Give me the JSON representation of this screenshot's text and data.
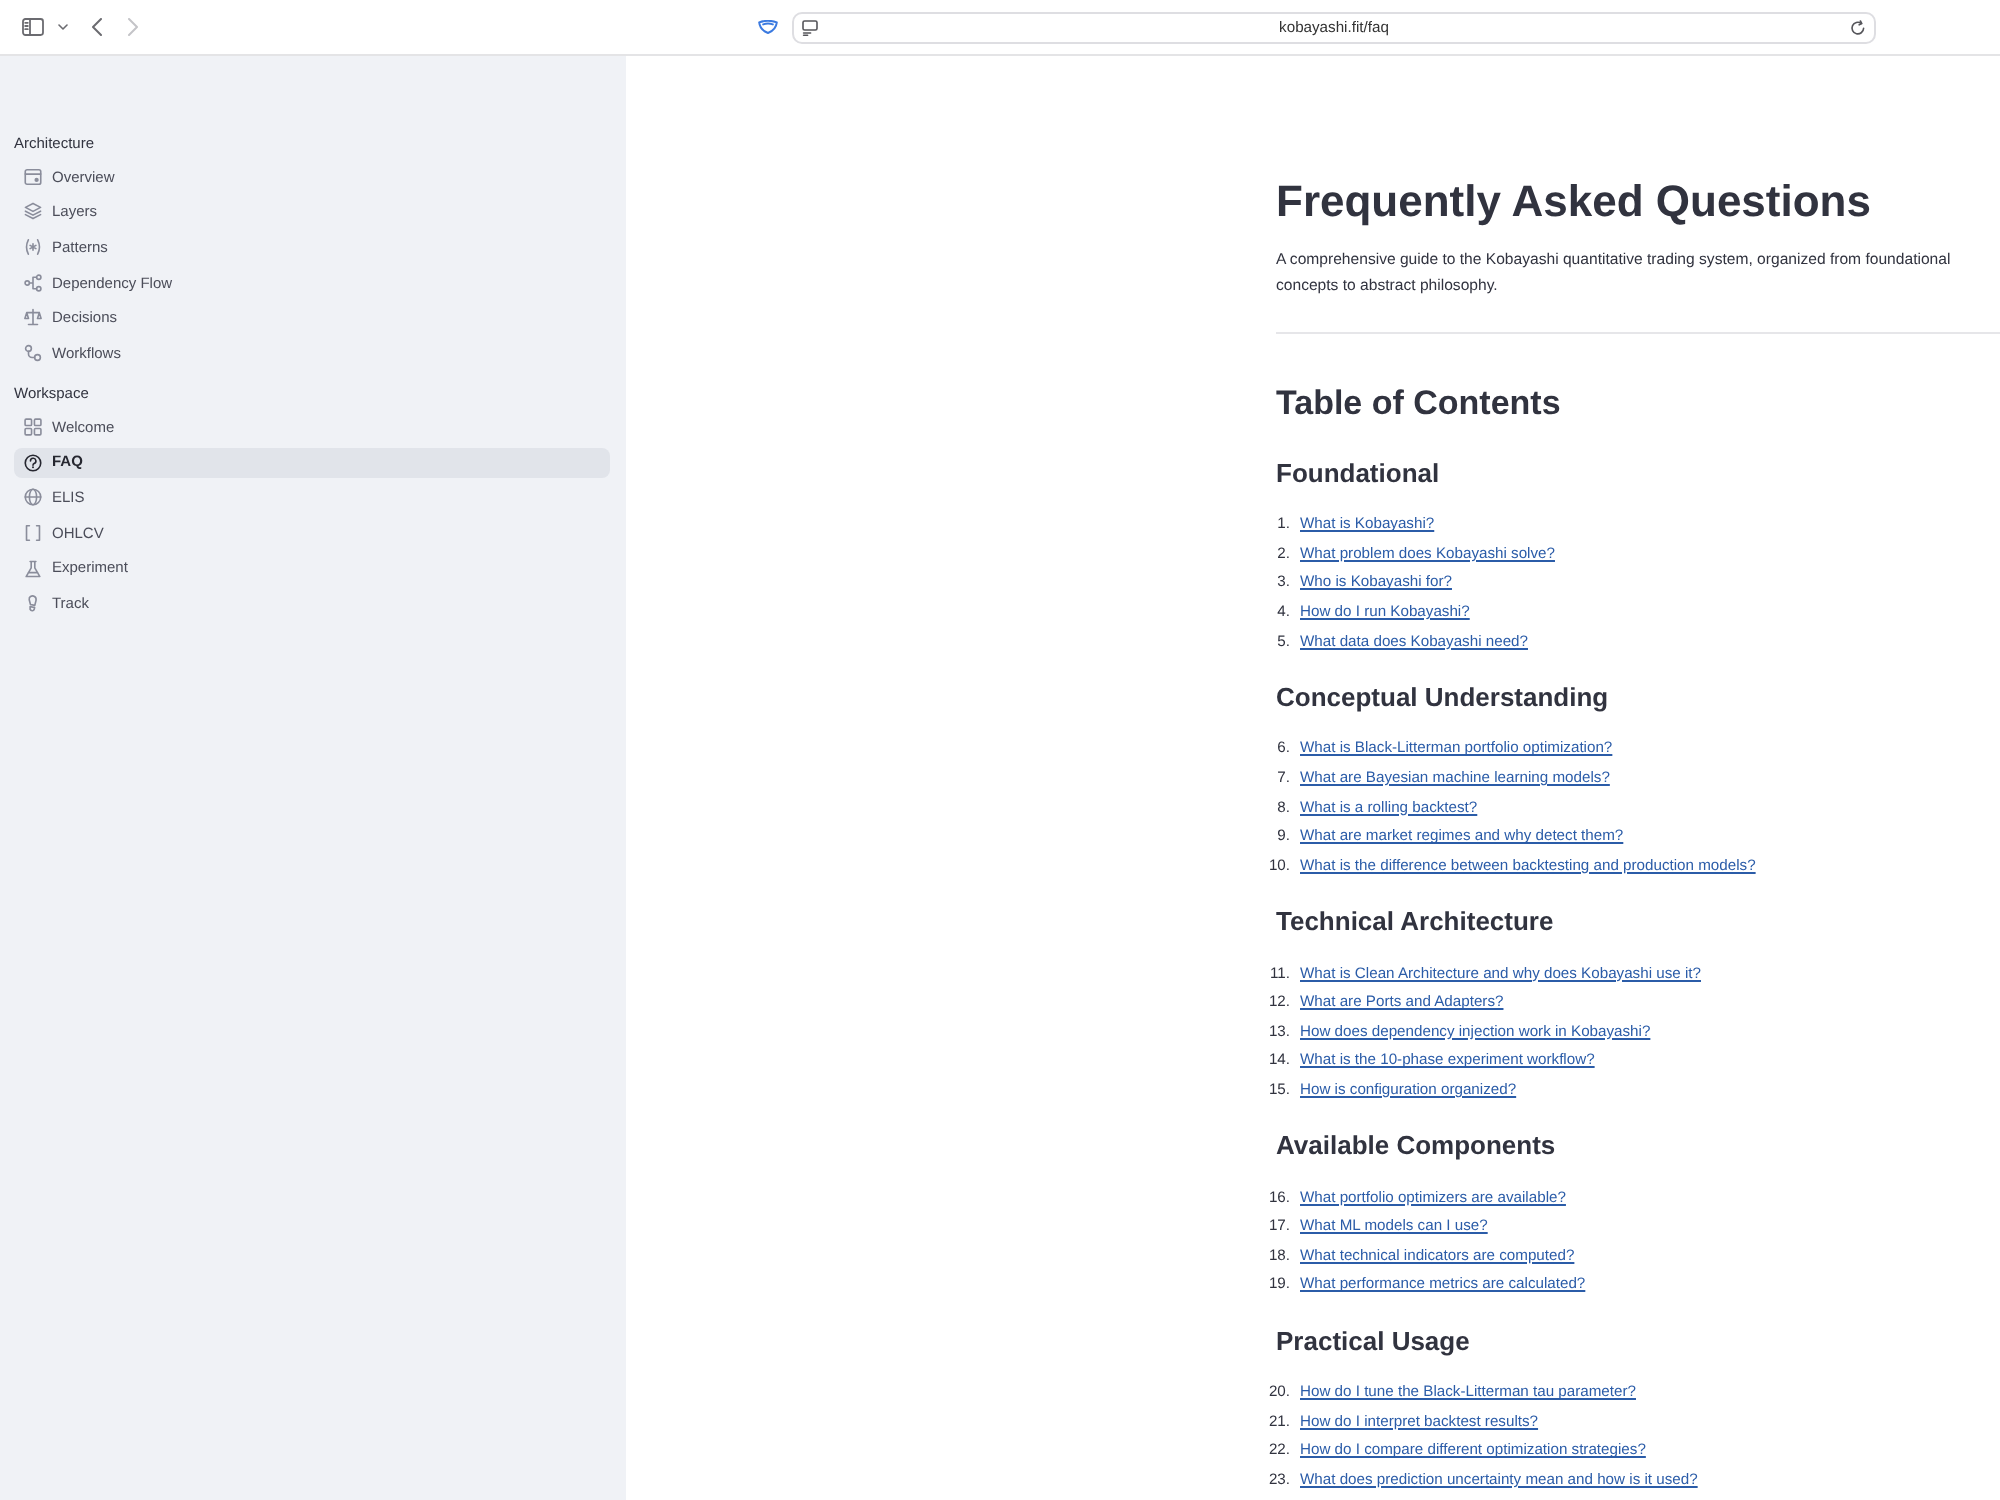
{
  "browser": {
    "url": "kobayashi.fit/faq"
  },
  "sidebar": {
    "sections": [
      {
        "title": "Architecture",
        "items": [
          {
            "label": "Overview",
            "selected": false
          },
          {
            "label": "Layers",
            "selected": false
          },
          {
            "label": "Patterns",
            "selected": false
          },
          {
            "label": "Dependency Flow",
            "selected": false
          },
          {
            "label": "Decisions",
            "selected": false
          },
          {
            "label": "Workflows",
            "selected": false
          }
        ]
      },
      {
        "title": "Workspace",
        "items": [
          {
            "label": "Welcome",
            "selected": false
          },
          {
            "label": "FAQ",
            "selected": true
          },
          {
            "label": "ELIS",
            "selected": false
          },
          {
            "label": "OHLCV",
            "selected": false
          },
          {
            "label": "Experiment",
            "selected": false
          },
          {
            "label": "Track",
            "selected": false
          }
        ]
      }
    ]
  },
  "page": {
    "title": "Frequently Asked Questions",
    "intro": "A comprehensive guide to the Kobayashi quantitative trading system, organized from foundational concepts to abstract philosophy.",
    "toc_title": "Table of Contents",
    "groups": [
      {
        "heading": "Foundational",
        "items": [
          {
            "number": "1.",
            "text": "What is Kobayashi?"
          },
          {
            "number": "2.",
            "text": "What problem does Kobayashi solve?"
          },
          {
            "number": "3.",
            "text": "Who is Kobayashi for?"
          },
          {
            "number": "4.",
            "text": "How do I run Kobayashi?"
          },
          {
            "number": "5.",
            "text": "What data does Kobayashi need?"
          }
        ]
      },
      {
        "heading": "Conceptual Understanding",
        "items": [
          {
            "number": "6.",
            "text": "What is Black-Litterman portfolio optimization?"
          },
          {
            "number": "7.",
            "text": "What are Bayesian machine learning models?"
          },
          {
            "number": "8.",
            "text": "What is a rolling backtest?"
          },
          {
            "number": "9.",
            "text": "What are market regimes and why detect them?"
          },
          {
            "number": "10.",
            "text": "What is the difference between backtesting and production models?"
          }
        ]
      },
      {
        "heading": "Technical Architecture",
        "items": [
          {
            "number": "11.",
            "text": "What is Clean Architecture and why does Kobayashi use it?"
          },
          {
            "number": "12.",
            "text": "What are Ports and Adapters?"
          },
          {
            "number": "13.",
            "text": "How does dependency injection work in Kobayashi?"
          },
          {
            "number": "14.",
            "text": "What is the 10-phase experiment workflow?"
          },
          {
            "number": "15.",
            "text": "How is configuration organized?"
          }
        ]
      },
      {
        "heading": "Available Components",
        "items": [
          {
            "number": "16.",
            "text": "What portfolio optimizers are available?"
          },
          {
            "number": "17.",
            "text": "What ML models can I use?"
          },
          {
            "number": "18.",
            "text": "What technical indicators are computed?"
          },
          {
            "number": "19.",
            "text": "What performance metrics are calculated?"
          }
        ]
      },
      {
        "heading": "Practical Usage",
        "items": [
          {
            "number": "20.",
            "text": "How do I tune the Black-Litterman tau parameter?"
          },
          {
            "number": "21.",
            "text": "How do I interpret backtest results?"
          },
          {
            "number": "22.",
            "text": "How do I compare different optimization strategies?"
          },
          {
            "number": "23.",
            "text": "What does prediction uncertainty mean and how is it used?"
          }
        ]
      }
    ]
  }
}
